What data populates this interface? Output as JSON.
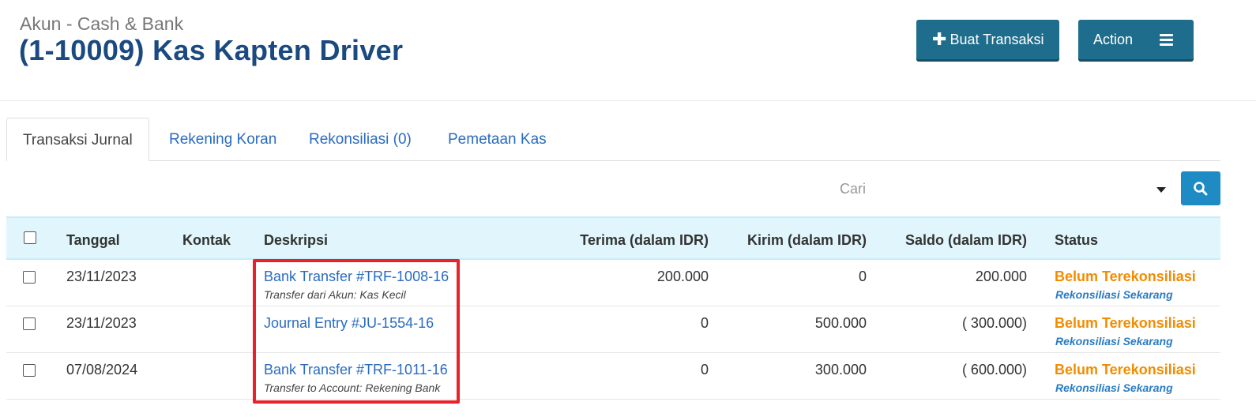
{
  "header": {
    "subtitle": "Akun - Cash & Bank",
    "title": "(1-10009) Kas Kapten Driver",
    "create_button": "Buat Transaksi",
    "action_button": "Action"
  },
  "tabs": [
    {
      "label": "Transaksi Jurnal",
      "active": true
    },
    {
      "label": "Rekening Koran"
    },
    {
      "label": "Rekonsiliasi (0)"
    },
    {
      "label": "Pemetaan Kas"
    }
  ],
  "search": {
    "placeholder": "Cari"
  },
  "table": {
    "headers": {
      "date": "Tanggal",
      "contact": "Kontak",
      "description": "Deskripsi",
      "receive": "Terima (dalam IDR)",
      "send": "Kirim (dalam IDR)",
      "balance": "Saldo (dalam IDR)",
      "status": "Status"
    },
    "rows": [
      {
        "date": "23/11/2023",
        "contact": "",
        "description": "Bank Transfer #TRF-1008-16",
        "note": "Transfer dari Akun: Kas Kecil",
        "receive": "200.000",
        "send": "0",
        "balance": "200.000",
        "status": "Belum Terekonsiliasi",
        "action": "Rekonsiliasi Sekarang"
      },
      {
        "date": "23/11/2023",
        "contact": "",
        "description": "Journal Entry #JU-1554-16",
        "note": "",
        "receive": "0",
        "send": "500.000",
        "balance": "( 300.000)",
        "status": "Belum Terekonsiliasi",
        "action": "Rekonsiliasi Sekarang"
      },
      {
        "date": "07/08/2024",
        "contact": "",
        "description": "Bank Transfer #TRF-1011-16",
        "note": "Transfer to Account: Rekening Bank",
        "receive": "0",
        "send": "300.000",
        "balance": "( 600.000)",
        "status": "Belum Terekonsiliasi",
        "action": "Rekonsiliasi Sekarang"
      }
    ]
  },
  "colors": {
    "title": "#1a4a80",
    "button": "#1f6d8c",
    "link": "#2a6bc2",
    "status_pending": "#f28c00",
    "highlight": "#e8222b",
    "table_header_bg": "#e0f6fc"
  },
  "icons": {
    "create": "plus-icon",
    "action": "hamburger-menu-icon",
    "search": "search-icon",
    "dropdown": "caret-down-icon"
  }
}
